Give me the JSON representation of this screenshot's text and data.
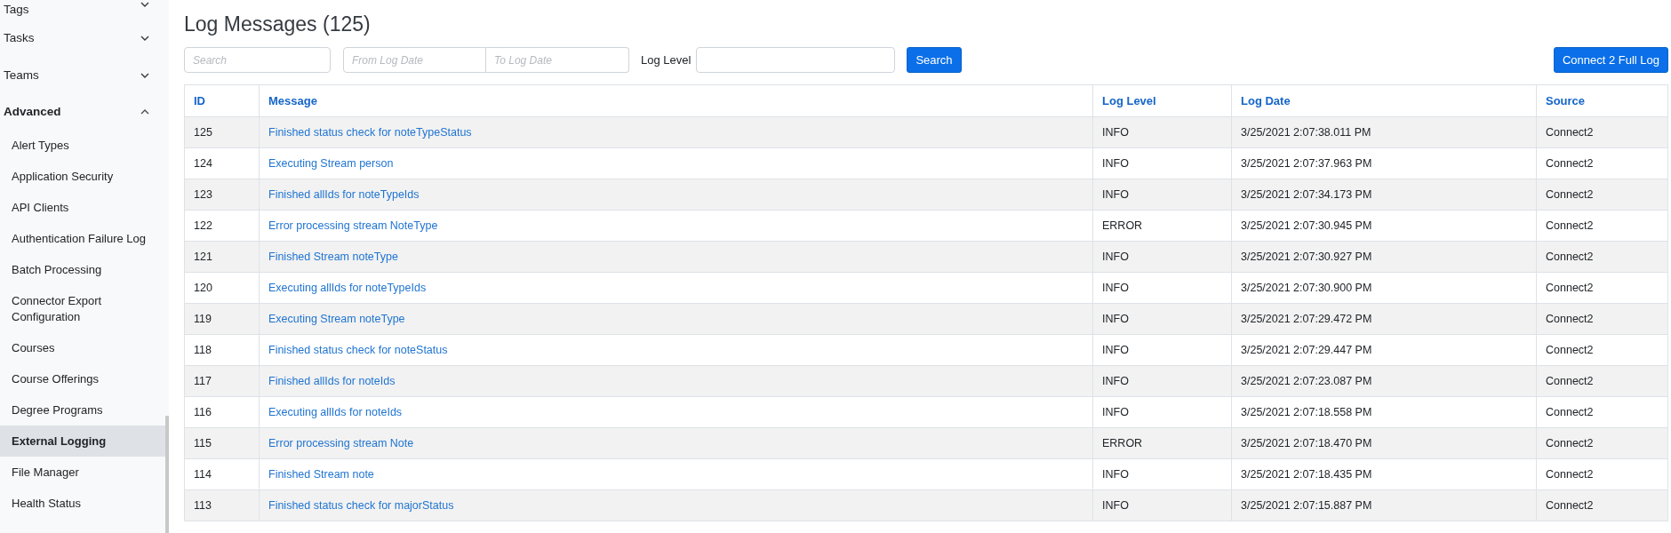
{
  "sidebar": {
    "items": [
      {
        "label": "Tags",
        "expanded": false,
        "selected": false
      },
      {
        "label": "Tasks",
        "expanded": false,
        "selected": false
      },
      {
        "label": "Teams",
        "expanded": false,
        "selected": false
      },
      {
        "label": "Advanced",
        "expanded": true,
        "selected": false,
        "children": [
          {
            "label": "Alert Types",
            "selected": false
          },
          {
            "label": "Application Security",
            "selected": false
          },
          {
            "label": "API Clients",
            "selected": false
          },
          {
            "label": "Authentication Failure Log",
            "selected": false
          },
          {
            "label": "Batch Processing",
            "selected": false
          },
          {
            "label": "Connector Export Configuration",
            "selected": false
          },
          {
            "label": "Courses",
            "selected": false
          },
          {
            "label": "Course Offerings",
            "selected": false
          },
          {
            "label": "Degree Programs",
            "selected": false
          },
          {
            "label": "External Logging",
            "selected": true
          },
          {
            "label": "File Manager",
            "selected": false
          },
          {
            "label": "Health Status",
            "selected": false
          }
        ]
      }
    ]
  },
  "page": {
    "title": "Log Messages (125)"
  },
  "filters": {
    "search": {
      "placeholder": "Search"
    },
    "from_date": {
      "placeholder": "From Log Date"
    },
    "to_date": {
      "placeholder": "To Log Date"
    },
    "log_level": {
      "label": "Log Level"
    },
    "search_button": "Search",
    "full_log_button": "Connect 2 Full Log"
  },
  "table": {
    "columns": [
      {
        "label": "ID"
      },
      {
        "label": "Message"
      },
      {
        "label": "Log Level"
      },
      {
        "label": "Log Date"
      },
      {
        "label": "Source"
      }
    ],
    "rows": [
      {
        "id": "125",
        "message": "Finished status check for noteTypeStatus",
        "log_level": "INFO",
        "log_date": "3/25/2021 2:07:38.011 PM",
        "source": "Connect2"
      },
      {
        "id": "124",
        "message": "Executing Stream person",
        "log_level": "INFO",
        "log_date": "3/25/2021 2:07:37.963 PM",
        "source": "Connect2"
      },
      {
        "id": "123",
        "message": "Finished allIds for noteTypeIds",
        "log_level": "INFO",
        "log_date": "3/25/2021 2:07:34.173 PM",
        "source": "Connect2"
      },
      {
        "id": "122",
        "message": "Error processing stream NoteType",
        "log_level": "ERROR",
        "log_date": "3/25/2021 2:07:30.945 PM",
        "source": "Connect2"
      },
      {
        "id": "121",
        "message": "Finished Stream noteType",
        "log_level": "INFO",
        "log_date": "3/25/2021 2:07:30.927 PM",
        "source": "Connect2"
      },
      {
        "id": "120",
        "message": "Executing allIds for noteTypeIds",
        "log_level": "INFO",
        "log_date": "3/25/2021 2:07:30.900 PM",
        "source": "Connect2"
      },
      {
        "id": "119",
        "message": "Executing Stream noteType",
        "log_level": "INFO",
        "log_date": "3/25/2021 2:07:29.472 PM",
        "source": "Connect2"
      },
      {
        "id": "118",
        "message": "Finished status check for noteStatus",
        "log_level": "INFO",
        "log_date": "3/25/2021 2:07:29.447 PM",
        "source": "Connect2"
      },
      {
        "id": "117",
        "message": "Finished allIds for noteIds",
        "log_level": "INFO",
        "log_date": "3/25/2021 2:07:23.087 PM",
        "source": "Connect2"
      },
      {
        "id": "116",
        "message": "Executing allIds for noteIds",
        "log_level": "INFO",
        "log_date": "3/25/2021 2:07:18.558 PM",
        "source": "Connect2"
      },
      {
        "id": "115",
        "message": "Error processing stream Note",
        "log_level": "ERROR",
        "log_date": "3/25/2021 2:07:18.470 PM",
        "source": "Connect2"
      },
      {
        "id": "114",
        "message": "Finished Stream note",
        "log_level": "INFO",
        "log_date": "3/25/2021 2:07:18.435 PM",
        "source": "Connect2"
      },
      {
        "id": "113",
        "message": "Finished status check for majorStatus",
        "log_level": "INFO",
        "log_date": "3/25/2021 2:07:15.887 PM",
        "source": "Connect2"
      }
    ]
  }
}
